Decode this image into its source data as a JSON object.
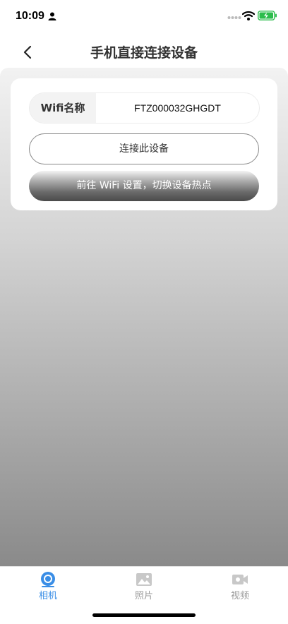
{
  "status_bar": {
    "time": "10:09"
  },
  "nav": {
    "title": "手机直接连接设备"
  },
  "card": {
    "wifi_label": "Wifi名称",
    "wifi_value": "FTZ000032GHGDT",
    "connect_button": "连接此设备",
    "settings_button": "前往 WiFi 设置，切换设备热点"
  },
  "tabs": [
    {
      "label": "相机",
      "icon": "camera-lens-icon",
      "active": true
    },
    {
      "label": "照片",
      "icon": "photo-icon",
      "active": false
    },
    {
      "label": "视频",
      "icon": "video-icon",
      "active": false
    }
  ],
  "colors": {
    "accent": "#3a8ee6",
    "inactive": "#999999"
  }
}
